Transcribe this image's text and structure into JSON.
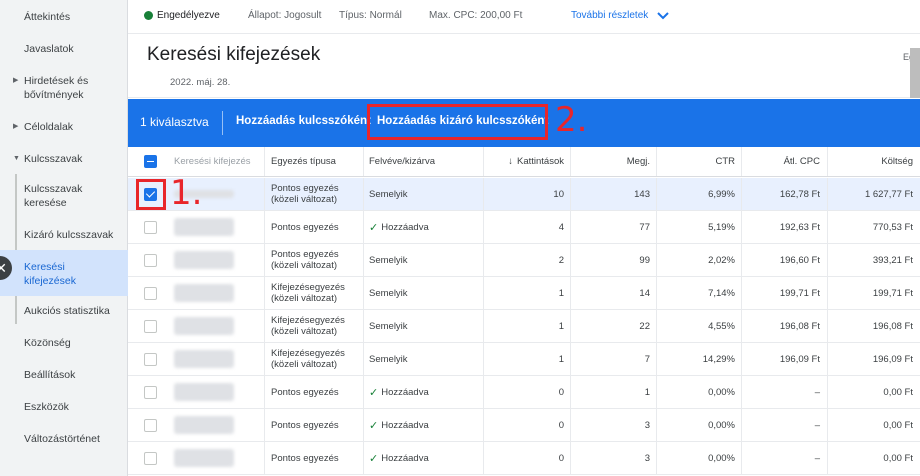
{
  "sidebar": {
    "items": [
      {
        "label": "Áttekintés"
      },
      {
        "label": "Javaslatok"
      },
      {
        "label": "Hirdetések és bővítmények"
      },
      {
        "label": "Céloldalak"
      },
      {
        "label": "Kulcsszavak"
      },
      {
        "label": "Kulcsszavak keresése"
      },
      {
        "label": "Kizáró kulcsszavak"
      },
      {
        "label": "Keresési kifejezések"
      },
      {
        "label": "Aukciós statisztika"
      },
      {
        "label": "Közönség"
      },
      {
        "label": "Beállítások"
      },
      {
        "label": "Eszközök"
      },
      {
        "label": "Változástörténet"
      }
    ],
    "close_glyph": "✕"
  },
  "status": {
    "name": "Engedélyezve",
    "state": "Állapot: Jogosult",
    "type": "Típus: Normál",
    "maxcpc": "Max. CPC: 200,00 Ft",
    "more": "További részletek"
  },
  "page": {
    "title": "Keresési kifejezések",
    "right": "Eg",
    "date": "2022. máj. 28."
  },
  "actionbar": {
    "selected": "1 kiválasztva",
    "add_keyword": "Hozzáadás kulcsszóként",
    "add_negative": "Hozzáadás kizáró kulcsszóként"
  },
  "annotations": {
    "one": "1.",
    "two": "2."
  },
  "colors": {
    "accent": "#1a73e8",
    "annotation_red": "#e8262b",
    "status_green": "#188038"
  },
  "table": {
    "headers": {
      "term": "Keresési kifejezés",
      "match": "Egyezés típusa",
      "added": "Felvéve/kizárva",
      "clicks": "Kattintások",
      "impr": "Megj.",
      "ctr": "CTR",
      "cpc": "Átl. CPC",
      "cost": "Költség"
    },
    "sort_glyph": "↓",
    "rows": [
      {
        "match1": "Pontos egyezés",
        "match2": "(közeli változat)",
        "added": "Semelyik",
        "added_check": false,
        "clicks": "10",
        "impr": "143",
        "ctr": "6,99%",
        "cpc": "162,78 Ft",
        "cost": "1 627,77 Ft",
        "selected": true
      },
      {
        "match1": "Pontos egyezés",
        "match2": "",
        "added": "Hozzáadva",
        "added_check": true,
        "clicks": "4",
        "impr": "77",
        "ctr": "5,19%",
        "cpc": "192,63 Ft",
        "cost": "770,53 Ft",
        "selected": false
      },
      {
        "match1": "Pontos egyezés",
        "match2": "(közeli változat)",
        "added": "Semelyik",
        "added_check": false,
        "clicks": "2",
        "impr": "99",
        "ctr": "2,02%",
        "cpc": "196,60 Ft",
        "cost": "393,21 Ft",
        "selected": false
      },
      {
        "match1": "Kifejezésegyezés",
        "match2": "(közeli változat)",
        "added": "Semelyik",
        "added_check": false,
        "clicks": "1",
        "impr": "14",
        "ctr": "7,14%",
        "cpc": "199,71 Ft",
        "cost": "199,71 Ft",
        "selected": false
      },
      {
        "match1": "Kifejezésegyezés",
        "match2": "(közeli változat)",
        "added": "Semelyik",
        "added_check": false,
        "clicks": "1",
        "impr": "22",
        "ctr": "4,55%",
        "cpc": "196,08 Ft",
        "cost": "196,08 Ft",
        "selected": false
      },
      {
        "match1": "Kifejezésegyezés",
        "match2": "(közeli változat)",
        "added": "Semelyik",
        "added_check": false,
        "clicks": "1",
        "impr": "7",
        "ctr": "14,29%",
        "cpc": "196,09 Ft",
        "cost": "196,09 Ft",
        "selected": false
      },
      {
        "match1": "Pontos egyezés",
        "match2": "",
        "added": "Hozzáadva",
        "added_check": true,
        "clicks": "0",
        "impr": "1",
        "ctr": "0,00%",
        "cpc": "–",
        "cost": "0,00 Ft",
        "selected": false
      },
      {
        "match1": "Pontos egyezés",
        "match2": "",
        "added": "Hozzáadva",
        "added_check": true,
        "clicks": "0",
        "impr": "3",
        "ctr": "0,00%",
        "cpc": "–",
        "cost": "0,00 Ft",
        "selected": false
      },
      {
        "match1": "Pontos egyezés",
        "match2": "",
        "added": "Hozzáadva",
        "added_check": true,
        "clicks": "0",
        "impr": "3",
        "ctr": "0,00%",
        "cpc": "–",
        "cost": "0,00 Ft",
        "selected": false
      }
    ]
  }
}
